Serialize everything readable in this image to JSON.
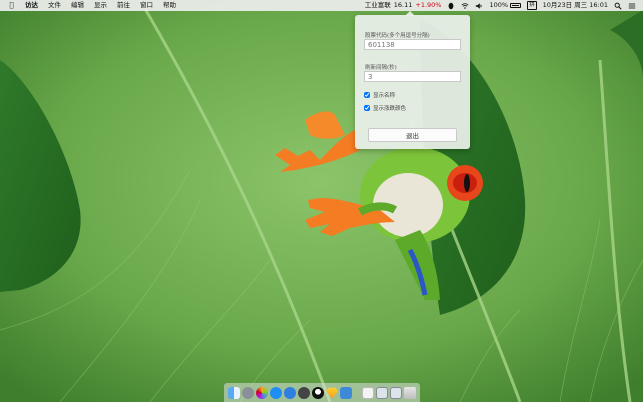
{
  "menubar": {
    "app_name": "访达",
    "menus": [
      "文件",
      "编辑",
      "显示",
      "前往",
      "窗口",
      "帮助"
    ],
    "stock_name": "工业富联",
    "stock_price": "16.11",
    "stock_change": "+1.90%",
    "battery_percent": "100%",
    "input_method": "拼",
    "datetime": "10月23日 周三  16:01"
  },
  "popup": {
    "code_label": "股票代码(多个用逗号分隔)",
    "code_placeholder": "601138",
    "interval_label": "刷新间隔(秒)",
    "interval_placeholder": "3",
    "show_name_label": "显示名称",
    "show_color_label": "显示涨跌颜色",
    "show_name_checked": true,
    "show_color_checked": true,
    "quit_label": "退出"
  },
  "colors": {
    "rise": "#d0021b",
    "leaf": "#5a9a3f"
  },
  "icons": [
    "apple-icon",
    "qq-icon",
    "wifi-icon",
    "volume-icon",
    "battery-icon",
    "spotlight-icon",
    "notification-center-icon"
  ]
}
